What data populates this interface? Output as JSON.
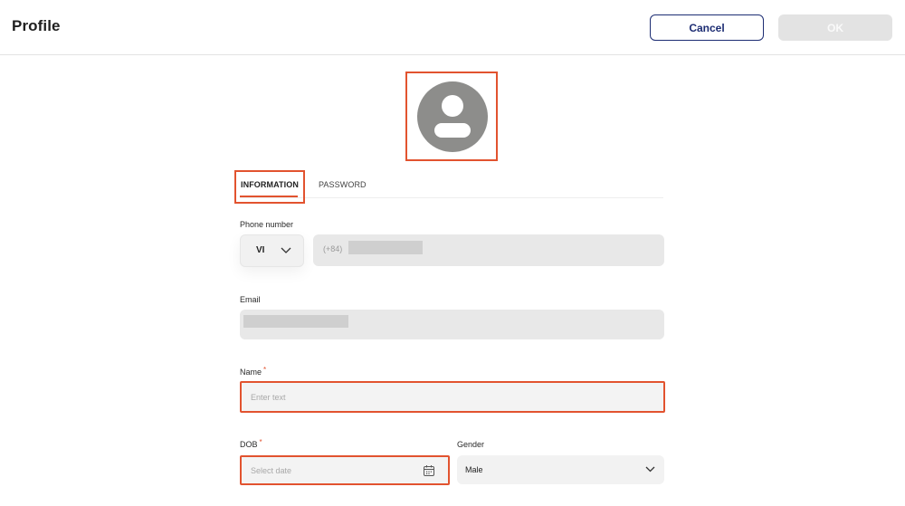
{
  "header": {
    "title": "Profile",
    "cancel_label": "Cancel",
    "ok_label": "OK"
  },
  "avatar": {
    "icon": "user-avatar-icon"
  },
  "tabs": [
    {
      "label": "INFORMATION",
      "active": true
    },
    {
      "label": "PASSWORD",
      "active": false
    }
  ],
  "form": {
    "phone": {
      "label": "Phone number",
      "country_code": "VI",
      "prefix": "(+84)"
    },
    "email": {
      "label": "Email"
    },
    "name": {
      "label": "Name",
      "required_mark": "*",
      "placeholder": "Enter text",
      "value": ""
    },
    "dob": {
      "label": "DOB",
      "required_mark": "*",
      "placeholder": "Select date",
      "icon": "calendar-icon"
    },
    "gender": {
      "label": "Gender",
      "value": "Male"
    }
  },
  "colors": {
    "accent": "#e2532f",
    "primary": "#1d2d73",
    "field_bg": "#e8e8e8",
    "avatar_bg": "#8d8d8b"
  }
}
